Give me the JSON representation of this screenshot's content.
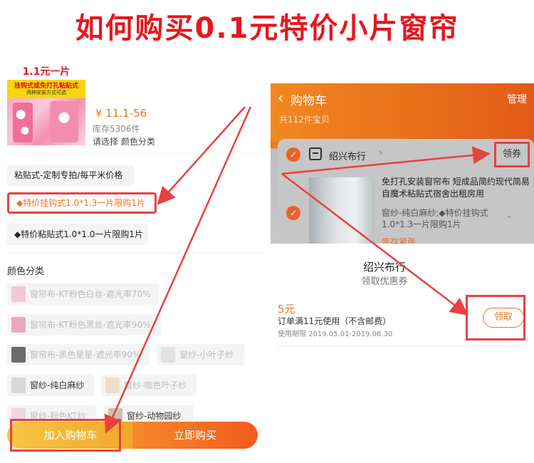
{
  "headline": "如何购买0.1元特价小片窗帘",
  "product": {
    "promo_top": "1.1元一片",
    "promo_line1": "挂钩式或免打孔粘贴式",
    "promo_line2": "两种安装方式可选",
    "price": "¥ 11.1-56",
    "stock": "库存5306件",
    "choose": "请选择 颜色分类"
  },
  "options": [
    "粘贴式-定制专拍/每平米价格",
    "◆特价挂钩式1.0*1.3一片限购1片",
    "◆特价粘贴式1.0*1.0一片限购1片"
  ],
  "color_section": {
    "title": "颜色分类",
    "items": [
      {
        "label": "窗帘布-KT粉色白丝-遮光率70%",
        "color": "#f1c9d6",
        "available": false
      },
      {
        "label": "窗帘布-KT粉色黑丝-遮光率90%",
        "color": "#e7aabd",
        "available": false
      },
      {
        "label": "窗帘布-黑色星星-遮光率90%",
        "color": "#6b6b6b",
        "available": false
      },
      {
        "label": "窗纱-小叶子纱",
        "color": "#e2e2e2",
        "available": false
      },
      {
        "label": "窗纱-纯白麻纱",
        "color": "#d5d9dc",
        "available": true
      },
      {
        "label": "窗纱-咖色叶子纱",
        "color": "#eae0cd",
        "available": false
      },
      {
        "label": "窗纱-粉色KT纱",
        "color": "#f0d6de",
        "available": false
      },
      {
        "label": "窗纱-动物园纱",
        "color": "#c7c2b4",
        "available": true
      }
    ]
  },
  "buttons": {
    "add_to_cart": "加入购物车",
    "buy_now": "立即购买"
  },
  "cart": {
    "title": "购物车",
    "manage": "管理",
    "count": "共112件宝贝",
    "shop_name": "绍兴布行",
    "coupon_label": "领券",
    "item_title": "免打孔安装窗帘布 短成品简约现代简易自魔术粘贴式宿舍出租房用",
    "item_sku": "窗纱-纯白麻纱;◆特价挂钩式1.0*1.3一片限购1片",
    "stock_status": "库存紧张"
  },
  "coupon_sheet": {
    "shop": "绍兴布行",
    "subtitle": "领取优惠券",
    "value": "5元",
    "condition": "订单满11元使用（不含邮费）",
    "validity": "使用期限 2019.05.01-2019.06.30",
    "claim": "领取"
  },
  "colors": {
    "accent_red": "#e8161e",
    "orange": "#f0731c",
    "highlight_box": "#e84141"
  }
}
